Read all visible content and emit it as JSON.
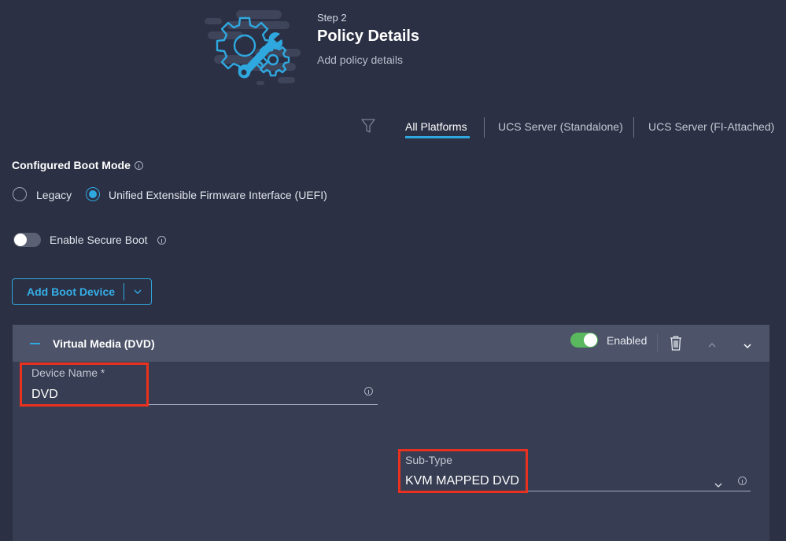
{
  "header": {
    "step": "Step 2",
    "title": "Policy Details",
    "subtitle": "Add policy details"
  },
  "platform_tabs": {
    "items": [
      {
        "label": "All Platforms",
        "active": true
      },
      {
        "label": "UCS Server (Standalone)",
        "active": false
      },
      {
        "label": "UCS Server (FI-Attached)",
        "active": false
      }
    ]
  },
  "boot_mode": {
    "label": "Configured Boot Mode",
    "options": [
      {
        "label": "Legacy",
        "selected": false
      },
      {
        "label": "Unified Extensible Firmware Interface (UEFI)",
        "selected": true
      }
    ]
  },
  "secure_boot": {
    "label": "Enable Secure Boot",
    "enabled": false
  },
  "add_boot_device": {
    "label": "Add Boot Device"
  },
  "boot_device": {
    "title": "Virtual Media (DVD)",
    "enabled_label": "Enabled",
    "enabled": true,
    "device_name": {
      "label": "Device Name *",
      "value": "DVD"
    },
    "sub_type": {
      "label": "Sub-Type",
      "value": "KVM MAPPED DVD"
    }
  },
  "colors": {
    "accent": "#2fa8e0",
    "background": "#2b3044",
    "panel": "#373d52",
    "panel_header": "#4d5369",
    "toggle_on": "#5ab85e",
    "highlight": "#e8321f"
  }
}
